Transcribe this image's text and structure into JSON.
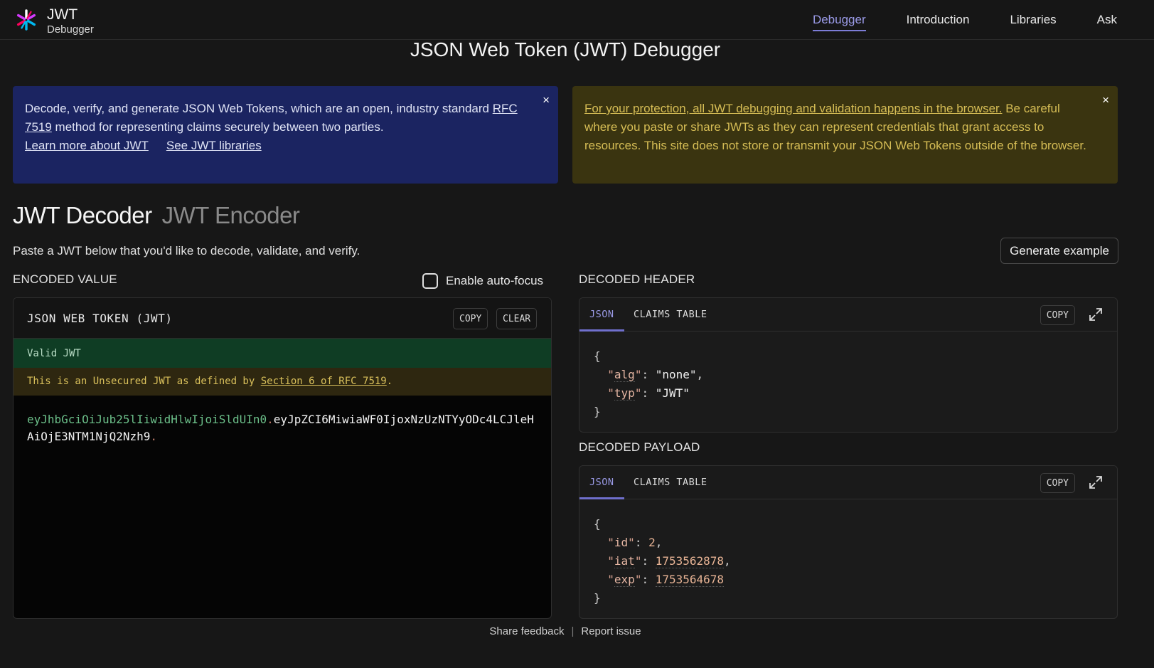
{
  "nav": {
    "brand_name": "JWT",
    "brand_sub": "Debugger",
    "links": [
      "Debugger",
      "Introduction",
      "Libraries",
      "Ask"
    ]
  },
  "page_title": "JSON Web Token (JWT) Debugger",
  "info_banner": {
    "text_before_link": "Decode, verify, and generate JSON Web Tokens, which are an open, industry standard ",
    "rfc_link": "RFC 7519",
    "text_after_link": " method for representing claims securely between two parties.",
    "learn_more": "Learn more about JWT",
    "see_libraries": "See JWT libraries",
    "close": "×"
  },
  "warn_banner": {
    "link_text": "For your protection, all JWT debugging and validation happens in the browser.",
    "text": " Be careful where you paste or share JWTs as they can represent credentials that grant access to resources. This site does not store or transmit your JSON Web Tokens outside of the browser.",
    "close": "×"
  },
  "modes": {
    "decoder": "JWT Decoder",
    "encoder": "JWT Encoder"
  },
  "instructions": "Paste a JWT below that you'd like to decode, validate, and verify.",
  "generate_example": "Generate example",
  "encoded": {
    "section_label": "ENCODED VALUE",
    "autofocus_label": "Enable auto-focus",
    "panel_title": "JSON WEB TOKEN (JWT)",
    "copy": "COPY",
    "clear": "CLEAR",
    "status_valid": "Valid JWT",
    "status_warn_before": "This is an Unsecured JWT as defined by ",
    "status_warn_link": "Section 6 of RFC 7519",
    "status_warn_after": ".",
    "token_header": "eyJhbGciOiJub25lIiwidHlwIjoiSldUIn0",
    "token_payload": "eyJpZCI6MiwiaWF0IjoxNzUzNTYyODc4LCJleHAiOjE3NTM1NjQ2Nzh9",
    "dot": "."
  },
  "decoded_header": {
    "section_label": "DECODED HEADER",
    "tab_json": "JSON",
    "tab_claims": "CLAIMS TABLE",
    "copy": "COPY",
    "alg_key": "alg",
    "alg_val": "none",
    "typ_key": "typ",
    "typ_val": "JWT"
  },
  "decoded_payload": {
    "section_label": "DECODED PAYLOAD",
    "tab_json": "JSON",
    "tab_claims": "CLAIMS TABLE",
    "copy": "COPY",
    "id_key": "id",
    "id_val": "2",
    "iat_key": "iat",
    "iat_val": "1753562878",
    "exp_key": "exp",
    "exp_val": "1753564678"
  },
  "footer": {
    "share_feedback": "Share feedback",
    "separator": "|",
    "report_issue": "Report issue"
  },
  "colors": {
    "accent": "#9b9be8",
    "info_banner_bg": "#1b2461",
    "warn_banner_bg": "#3a3410",
    "valid_bg": "#0f3d24"
  }
}
